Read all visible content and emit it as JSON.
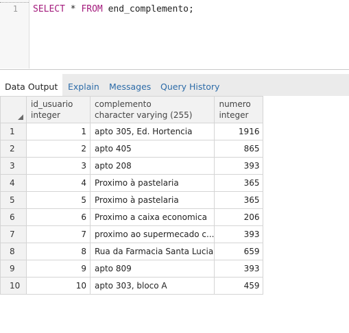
{
  "editor": {
    "line_number": "1",
    "sql_keyword_select": "SELECT",
    "sql_star": "*",
    "sql_keyword_from": "FROM",
    "sql_table": "end_complemento;"
  },
  "tabs": [
    {
      "label": "Data Output",
      "active": true
    },
    {
      "label": "Explain",
      "active": false
    },
    {
      "label": "Messages",
      "active": false
    },
    {
      "label": "Query History",
      "active": false
    }
  ],
  "grid": {
    "columns": [
      {
        "name": "id_usuario",
        "type": "integer"
      },
      {
        "name": "complemento",
        "type": "character varying (255)"
      },
      {
        "name": "numero",
        "type": "integer"
      }
    ],
    "rows": [
      {
        "row": "1",
        "id_usuario": "1",
        "complemento": "apto 305, Ed. Hortencia",
        "numero": "1916"
      },
      {
        "row": "2",
        "id_usuario": "2",
        "complemento": "apto 405",
        "numero": "865"
      },
      {
        "row": "3",
        "id_usuario": "3",
        "complemento": "apto 208",
        "numero": "393"
      },
      {
        "row": "4",
        "id_usuario": "4",
        "complemento": "Proximo à pastelaria",
        "numero": "365"
      },
      {
        "row": "5",
        "id_usuario": "5",
        "complemento": "Proximo à pastelaria",
        "numero": "365"
      },
      {
        "row": "6",
        "id_usuario": "6",
        "complemento": "Proximo a caixa economica",
        "numero": "206"
      },
      {
        "row": "7",
        "id_usuario": "7",
        "complemento": "proximo ao supermecado c...",
        "numero": "393"
      },
      {
        "row": "8",
        "id_usuario": "8",
        "complemento": "Rua da Farmacia Santa Lucia",
        "numero": "659"
      },
      {
        "row": "9",
        "id_usuario": "9",
        "complemento": "apto 809",
        "numero": "393"
      },
      {
        "row": "10",
        "id_usuario": "10",
        "complemento": "apto 303, bloco A",
        "numero": "459"
      }
    ]
  }
}
